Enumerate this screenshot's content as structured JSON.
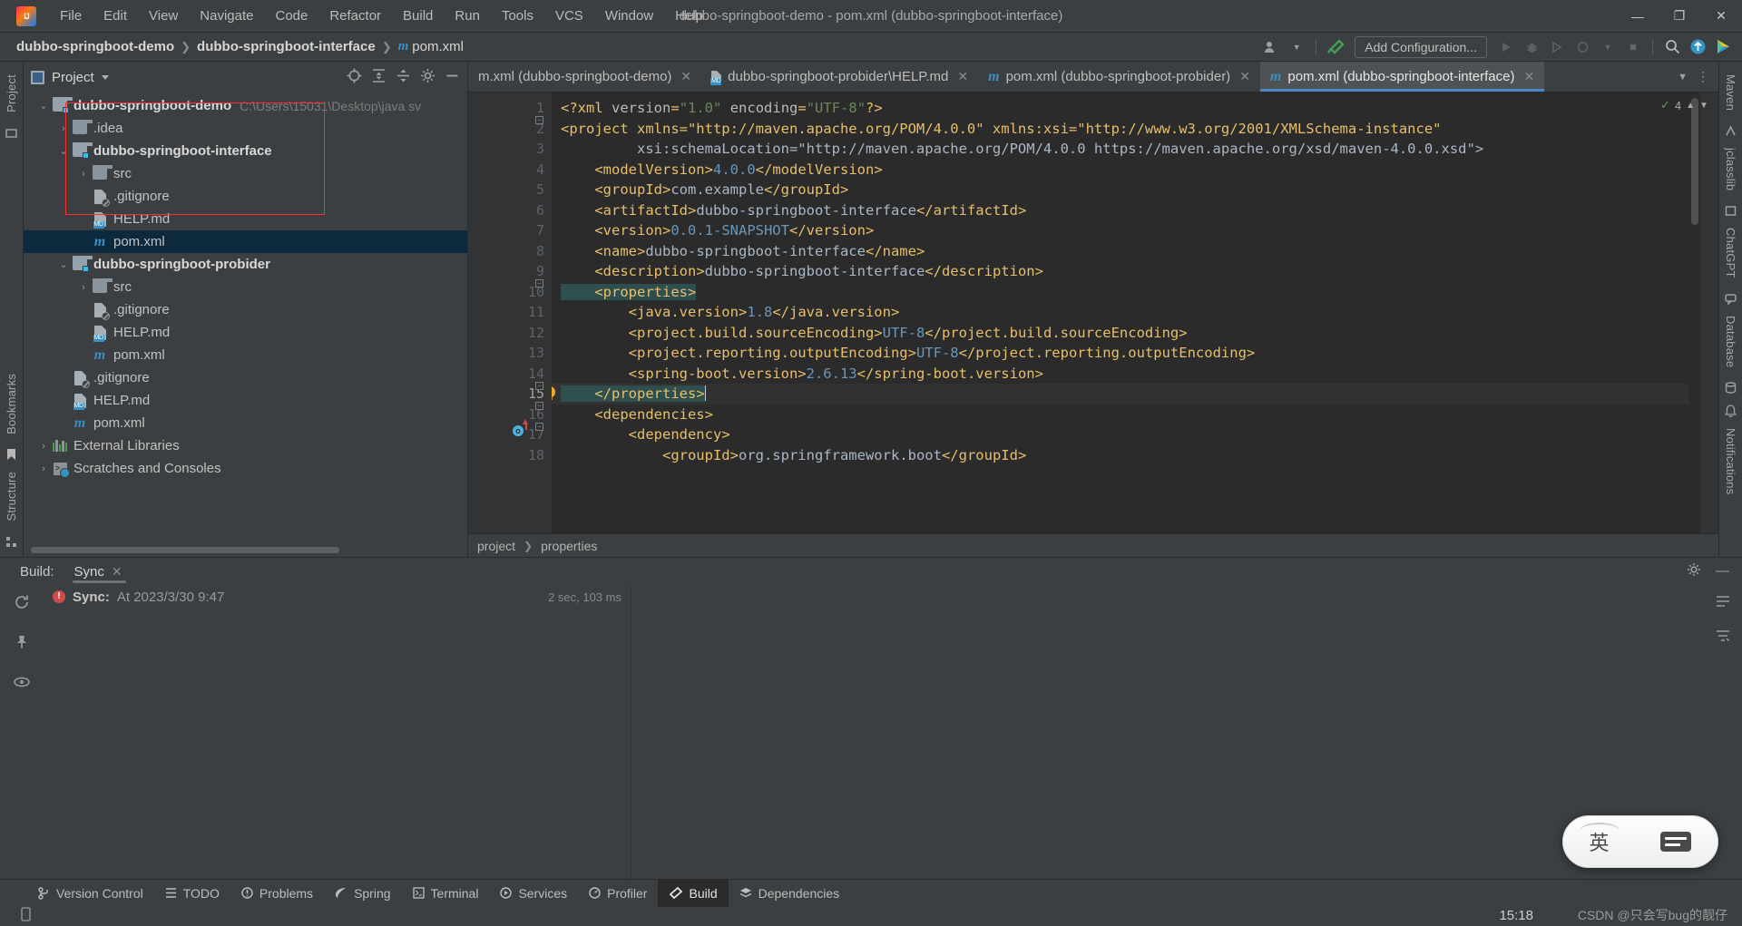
{
  "window": {
    "title": "dubbo-springboot-demo - pom.xml (dubbo-springboot-interface)",
    "logo_text": "IJ",
    "minimize": "—",
    "maximize": "❐",
    "close": "✕"
  },
  "menu": [
    {
      "label": "File"
    },
    {
      "label": "Edit"
    },
    {
      "label": "View"
    },
    {
      "label": "Navigate"
    },
    {
      "label": "Code"
    },
    {
      "label": "Refactor"
    },
    {
      "label": "Build"
    },
    {
      "label": "Run"
    },
    {
      "label": "Tools"
    },
    {
      "label": "VCS"
    },
    {
      "label": "Window"
    },
    {
      "label": "Help"
    }
  ],
  "navbar": {
    "breadcrumb": [
      "dubbo-springboot-demo",
      "dubbo-springboot-interface",
      "pom.xml"
    ],
    "maven_icon_text": "m",
    "add_configuration": "Add Configuration...",
    "run_icon": "▶",
    "debug_icon": "🐞",
    "coverage_icon": "▶|",
    "stop_icon": "■",
    "search_icon": "search-icon",
    "update_icon": "↑",
    "ide_icon": "ide-logo"
  },
  "left_strip": {
    "project_tab": "Project",
    "structure_tab": "Structure",
    "bookmarks_tab": "Bookmarks"
  },
  "right_strip": {
    "maven_tab": "Maven",
    "jclasslib_tab": "jclasslib",
    "chatgpt_tab": "ChatGPT",
    "database_tab": "Database",
    "notifications_tab": "Notifications"
  },
  "project_panel": {
    "title": "Project",
    "actions": [
      "locate-icon",
      "expand-all-icon",
      "collapse-all-icon",
      "settings-icon",
      "hide-icon"
    ],
    "tree": [
      {
        "label": "dubbo-springboot-demo",
        "path": "C:\\Users\\15031\\Desktop\\java sv",
        "indent": 0,
        "arrow": "down",
        "icon": "module-folder",
        "bold": true,
        "selected": false
      },
      {
        "label": ".idea",
        "path": "",
        "indent": 1,
        "arrow": "right",
        "icon": "folder",
        "bold": false,
        "selected": false
      },
      {
        "label": "dubbo-springboot-interface",
        "path": "",
        "indent": 1,
        "arrow": "down",
        "icon": "module-folder",
        "bold": true,
        "selected": false
      },
      {
        "label": "src",
        "path": "",
        "indent": 2,
        "arrow": "right",
        "icon": "folder",
        "bold": false,
        "selected": false
      },
      {
        "label": ".gitignore",
        "path": "",
        "indent": 2,
        "arrow": "none",
        "icon": "gitignore-file",
        "bold": false,
        "selected": false
      },
      {
        "label": "HELP.md",
        "path": "",
        "indent": 2,
        "arrow": "none",
        "icon": "markdown-file",
        "bold": false,
        "selected": false
      },
      {
        "label": "pom.xml",
        "path": "",
        "indent": 2,
        "arrow": "none",
        "icon": "maven-file",
        "bold": false,
        "selected": true
      },
      {
        "label": "dubbo-springboot-probider",
        "path": "",
        "indent": 1,
        "arrow": "down",
        "icon": "module-folder",
        "bold": true,
        "selected": false
      },
      {
        "label": "src",
        "path": "",
        "indent": 2,
        "arrow": "right",
        "icon": "folder",
        "bold": false,
        "selected": false
      },
      {
        "label": ".gitignore",
        "path": "",
        "indent": 2,
        "arrow": "none",
        "icon": "gitignore-file",
        "bold": false,
        "selected": false
      },
      {
        "label": "HELP.md",
        "path": "",
        "indent": 2,
        "arrow": "none",
        "icon": "markdown-file",
        "bold": false,
        "selected": false
      },
      {
        "label": "pom.xml",
        "path": "",
        "indent": 2,
        "arrow": "none",
        "icon": "maven-file",
        "bold": false,
        "selected": false
      },
      {
        "label": ".gitignore",
        "path": "",
        "indent": 1,
        "arrow": "none",
        "icon": "gitignore-file",
        "bold": false,
        "selected": false
      },
      {
        "label": "HELP.md",
        "path": "",
        "indent": 1,
        "arrow": "none",
        "icon": "markdown-file",
        "bold": false,
        "selected": false
      },
      {
        "label": "pom.xml",
        "path": "",
        "indent": 1,
        "arrow": "none",
        "icon": "maven-file",
        "bold": false,
        "selected": false
      },
      {
        "label": "External Libraries",
        "path": "",
        "indent": 0,
        "arrow": "right",
        "icon": "libraries",
        "bold": false,
        "selected": false
      },
      {
        "label": "Scratches and Consoles",
        "path": "",
        "indent": 0,
        "arrow": "right",
        "icon": "scratches",
        "bold": false,
        "selected": false
      }
    ]
  },
  "editor": {
    "tabs": [
      {
        "label": "m.xml (dubbo-springboot-demo)",
        "icon": "maven-file",
        "active": false,
        "show_icon": false
      },
      {
        "label": "dubbo-springboot-probider\\HELP.md",
        "icon": "markdown-file",
        "active": false,
        "show_icon": true
      },
      {
        "label": "pom.xml (dubbo-springboot-probider)",
        "icon": "maven-file",
        "active": false,
        "show_icon": true
      },
      {
        "label": "pom.xml (dubbo-springboot-interface)",
        "icon": "maven-file",
        "active": true,
        "show_icon": true
      }
    ],
    "tab_close": "✕",
    "tab_list_icon": "chevron-down-icon",
    "tab_more_icon": "more-vertical-icon",
    "inspection_count": "4",
    "inspection_ok": "✓",
    "line_numbers": [
      "1",
      "2",
      "3",
      "4",
      "5",
      "6",
      "7",
      "8",
      "9",
      "10",
      "11",
      "12",
      "13",
      "14",
      "15",
      "16",
      "17",
      "18"
    ],
    "code_lines": [
      "<?xml version=\"1.0\" encoding=\"UTF-8\"?>",
      "<project xmlns=\"http://maven.apache.org/POM/4.0.0\" xmlns:xsi=\"http://www.w3.org/2001/XMLSchema-instance\"",
      "         xsi:schemaLocation=\"http://maven.apache.org/POM/4.0.0 https://maven.apache.org/xsd/maven-4.0.0.xsd\">",
      "    <modelVersion>4.0.0</modelVersion>",
      "    <groupId>com.example</groupId>",
      "    <artifactId>dubbo-springboot-interface</artifactId>",
      "    <version>0.0.1-SNAPSHOT</version>",
      "    <name>dubbo-springboot-interface</name>",
      "    <description>dubbo-springboot-interface</description>",
      "    <properties>",
      "        <java.version>1.8</java.version>",
      "        <project.build.sourceEncoding>UTF-8</project.build.sourceEncoding>",
      "        <project.reporting.outputEncoding>UTF-8</project.reporting.outputEncoding>",
      "        <spring-boot.version>2.6.13</spring-boot.version>",
      "    </properties>",
      "    <dependencies>",
      "        <dependency>",
      "            <groupId>org.springframework.boot</groupId>"
    ],
    "breadcrumbs": [
      "project",
      "properties"
    ]
  },
  "build_panel": {
    "label": "Build:",
    "tab": "Sync",
    "tab_close": "✕",
    "settings_icon": "gear-icon",
    "minimize_icon": "minimize-icon",
    "left_actions": [
      "rerun-icon",
      "pin-icon",
      "eye-icon"
    ],
    "right_actions": [
      "list-icon",
      "filter-icon"
    ],
    "entry": {
      "prefix": "Sync:",
      "text": "At 2023/3/30 9:47",
      "duration": "2 sec, 103 ms",
      "status": "error"
    }
  },
  "status_bar": {
    "buttons": [
      {
        "label": "Version Control",
        "icon": "branch-icon",
        "active": false
      },
      {
        "label": "TODO",
        "icon": "list-icon",
        "active": false
      },
      {
        "label": "Problems",
        "icon": "warning-icon",
        "active": false
      },
      {
        "label": "Spring",
        "icon": "leaf-icon",
        "active": false
      },
      {
        "label": "Terminal",
        "icon": "terminal-icon",
        "active": false
      },
      {
        "label": "Services",
        "icon": "play-circle-icon",
        "active": false
      },
      {
        "label": "Profiler",
        "icon": "gauge-icon",
        "active": false
      },
      {
        "label": "Build",
        "icon": "hammer-icon",
        "active": true
      },
      {
        "label": "Dependencies",
        "icon": "layers-icon",
        "active": false
      }
    ]
  },
  "overlay": {
    "ime_lang": "英",
    "clock": "15:18",
    "watermark": "CSDN @只会写bug的靓仔"
  },
  "colors": {
    "accent": "#4a88c7",
    "selection": "#0d293e",
    "tag": "#e8bf6a",
    "value": "#6a8759",
    "attr_name": "#9876aa",
    "error": "#cc4b4b",
    "red_box": "#ff2d2d"
  }
}
